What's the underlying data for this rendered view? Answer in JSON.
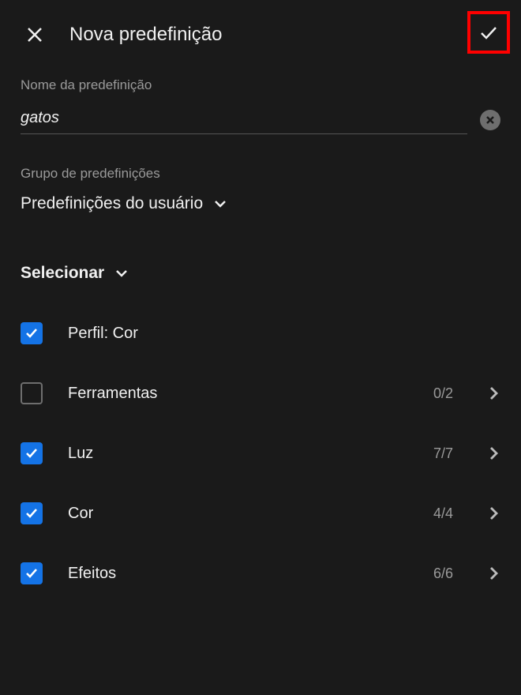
{
  "header": {
    "title": "Nova predefinição"
  },
  "presetName": {
    "label": "Nome da predefinição",
    "value": "gatos"
  },
  "group": {
    "label": "Grupo de predefinições",
    "selected": "Predefinições do usuário"
  },
  "select": {
    "label": "Selecionar"
  },
  "items": [
    {
      "label": "Perfil: Cor",
      "checked": true,
      "count": null,
      "hasChevron": false
    },
    {
      "label": "Ferramentas",
      "checked": false,
      "count": "0/2",
      "hasChevron": true
    },
    {
      "label": "Luz",
      "checked": true,
      "count": "7/7",
      "hasChevron": true
    },
    {
      "label": "Cor",
      "checked": true,
      "count": "4/4",
      "hasChevron": true
    },
    {
      "label": "Efeitos",
      "checked": true,
      "count": "6/6",
      "hasChevron": true
    }
  ]
}
